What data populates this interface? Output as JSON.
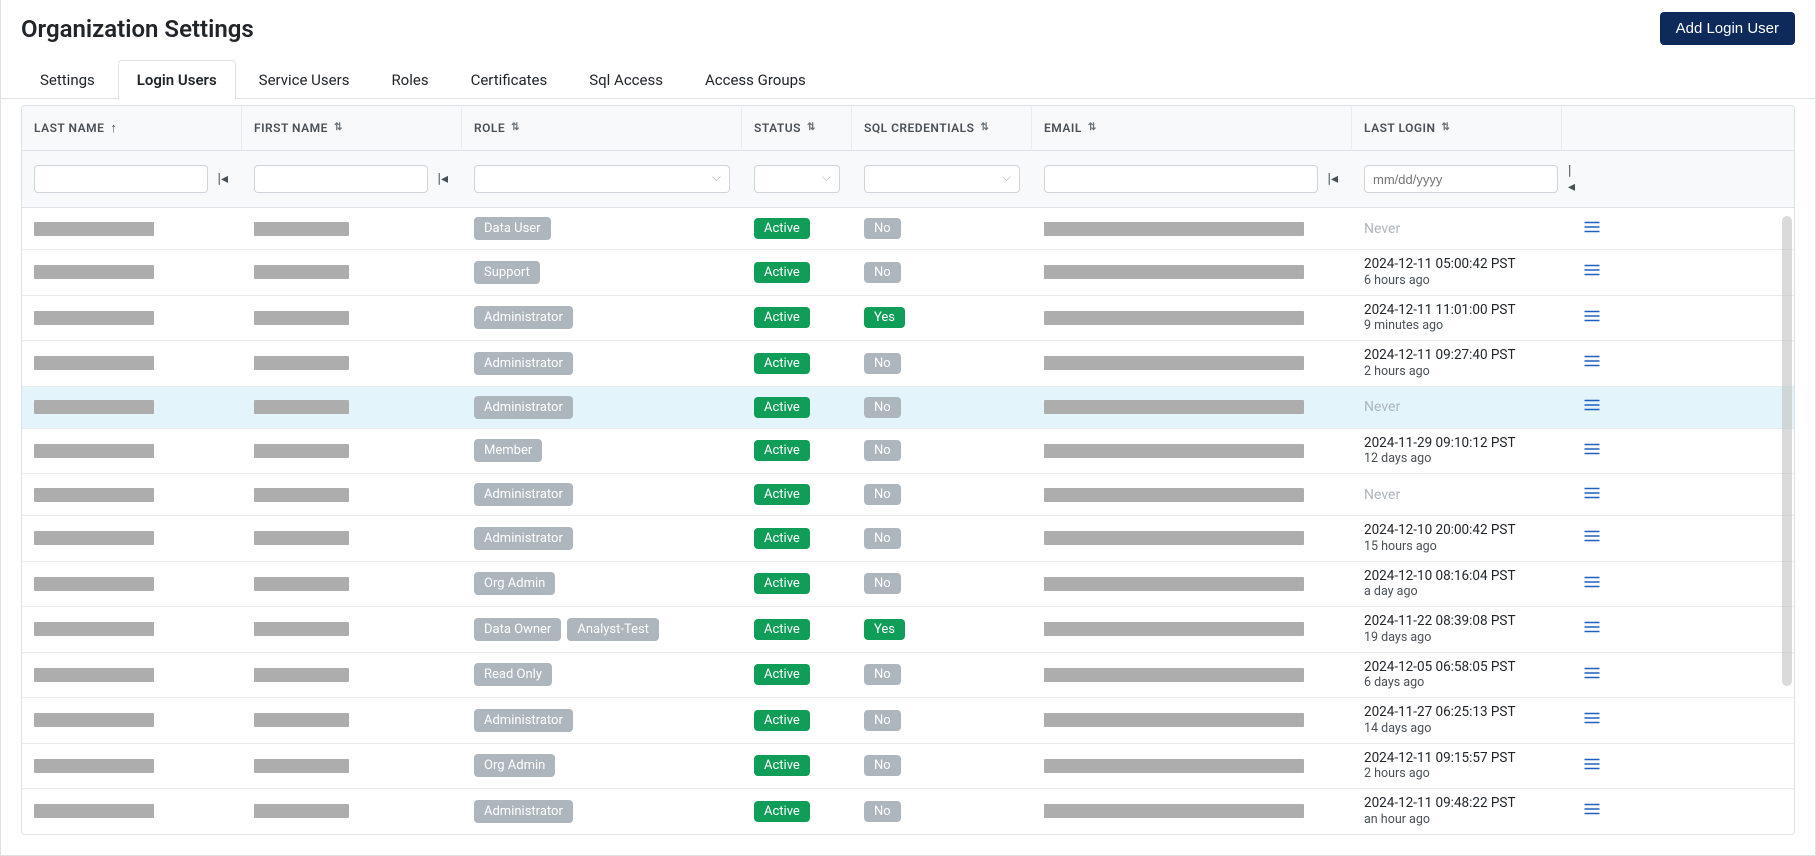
{
  "header": {
    "title": "Organization Settings",
    "add_button": "Add Login User"
  },
  "tabs": [
    {
      "id": "settings",
      "label": "Settings",
      "active": false
    },
    {
      "id": "login-users",
      "label": "Login Users",
      "active": true
    },
    {
      "id": "service-users",
      "label": "Service Users",
      "active": false
    },
    {
      "id": "roles",
      "label": "Roles",
      "active": false
    },
    {
      "id": "certificates",
      "label": "Certificates",
      "active": false
    },
    {
      "id": "sql-access",
      "label": "Sql Access",
      "active": false
    },
    {
      "id": "access-groups",
      "label": "Access Groups",
      "active": false
    }
  ],
  "columns": {
    "last_name": {
      "label": "LAST NAME",
      "sort": "asc"
    },
    "first_name": {
      "label": "FIRST NAME",
      "sort": "both"
    },
    "role": {
      "label": "ROLE",
      "sort": "both"
    },
    "status": {
      "label": "STATUS",
      "sort": "both"
    },
    "sql": {
      "label": "SQL CREDENTIALS",
      "sort": "both"
    },
    "email": {
      "label": "EMAIL",
      "sort": "both"
    },
    "last_login": {
      "label": "LAST LOGIN",
      "sort": "both"
    }
  },
  "filters": {
    "date_placeholder": "mm/dd/yyyy"
  },
  "status_labels": {
    "active": "Active"
  },
  "sql_labels": {
    "yes": "Yes",
    "no": "No"
  },
  "never_label": "Never",
  "rows": [
    {
      "roles": [
        "Data User"
      ],
      "status": "active",
      "sql": "no",
      "last_login": null,
      "highlight": false
    },
    {
      "roles": [
        "Support"
      ],
      "status": "active",
      "sql": "no",
      "last_login": {
        "ts": "2024-12-11 05:00:42 PST",
        "ago": "6 hours ago"
      },
      "highlight": false
    },
    {
      "roles": [
        "Administrator"
      ],
      "status": "active",
      "sql": "yes",
      "last_login": {
        "ts": "2024-12-11 11:01:00 PST",
        "ago": "9 minutes ago"
      },
      "highlight": false
    },
    {
      "roles": [
        "Administrator"
      ],
      "status": "active",
      "sql": "no",
      "last_login": {
        "ts": "2024-12-11 09:27:40 PST",
        "ago": "2 hours ago"
      },
      "highlight": false
    },
    {
      "roles": [
        "Administrator"
      ],
      "status": "active",
      "sql": "no",
      "last_login": null,
      "highlight": true
    },
    {
      "roles": [
        "Member"
      ],
      "status": "active",
      "sql": "no",
      "last_login": {
        "ts": "2024-11-29 09:10:12 PST",
        "ago": "12 days ago"
      },
      "highlight": false
    },
    {
      "roles": [
        "Administrator"
      ],
      "status": "active",
      "sql": "no",
      "last_login": null,
      "highlight": false
    },
    {
      "roles": [
        "Administrator"
      ],
      "status": "active",
      "sql": "no",
      "last_login": {
        "ts": "2024-12-10 20:00:42 PST",
        "ago": "15 hours ago"
      },
      "highlight": false
    },
    {
      "roles": [
        "Org Admin"
      ],
      "status": "active",
      "sql": "no",
      "last_login": {
        "ts": "2024-12-10 08:16:04 PST",
        "ago": "a day ago"
      },
      "highlight": false
    },
    {
      "roles": [
        "Data Owner",
        "Analyst-Test"
      ],
      "status": "active",
      "sql": "yes",
      "last_login": {
        "ts": "2024-11-22 08:39:08 PST",
        "ago": "19 days ago"
      },
      "highlight": false
    },
    {
      "roles": [
        "Read Only"
      ],
      "status": "active",
      "sql": "no",
      "last_login": {
        "ts": "2024-12-05 06:58:05 PST",
        "ago": "6 days ago"
      },
      "highlight": false
    },
    {
      "roles": [
        "Administrator"
      ],
      "status": "active",
      "sql": "no",
      "last_login": {
        "ts": "2024-11-27 06:25:13 PST",
        "ago": "14 days ago"
      },
      "highlight": false
    },
    {
      "roles": [
        "Org Admin"
      ],
      "status": "active",
      "sql": "no",
      "last_login": {
        "ts": "2024-12-11 09:15:57 PST",
        "ago": "2 hours ago"
      },
      "highlight": false
    },
    {
      "roles": [
        "Administrator"
      ],
      "status": "active",
      "sql": "no",
      "last_login": {
        "ts": "2024-12-11 09:48:22 PST",
        "ago": "an hour ago"
      },
      "highlight": false
    }
  ]
}
